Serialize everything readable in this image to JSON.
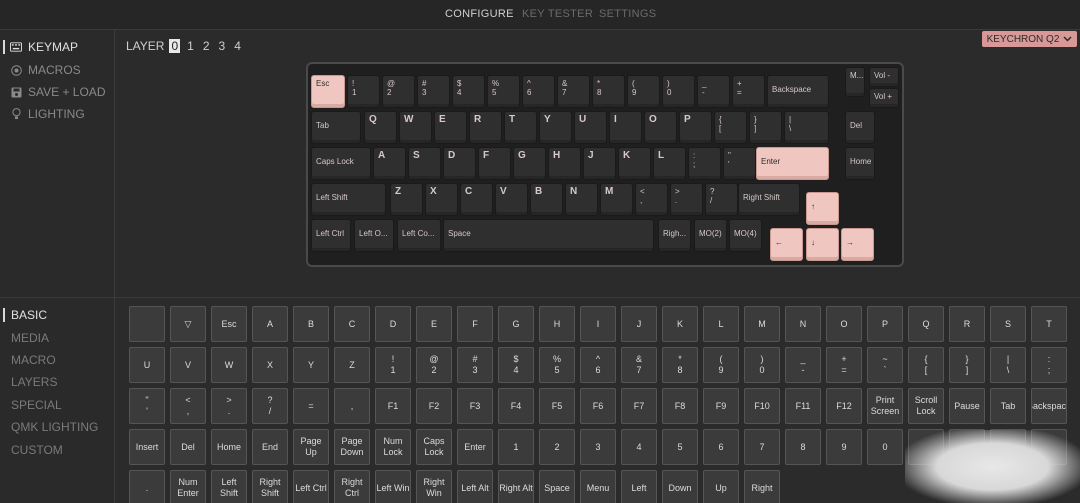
{
  "topbar": {
    "tabs": [
      "CONFIGURE",
      "KEY TESTER",
      "SETTINGS"
    ]
  },
  "sidebar_top": {
    "items": [
      "KEYMAP",
      "MACROS",
      "SAVE + LOAD",
      "LIGHTING"
    ]
  },
  "layer": {
    "label": "LAYER",
    "numbers": [
      "0",
      "1",
      "2",
      "3",
      "4"
    ]
  },
  "keyboard_dropdown": {
    "label": "KEYCHRON Q2"
  },
  "keys": {
    "r1": [
      [
        "Esc",
        ""
      ],
      [
        "!",
        "1"
      ],
      [
        "@",
        "2"
      ],
      [
        "#",
        "3"
      ],
      [
        "$",
        "4"
      ],
      [
        "%",
        "5"
      ],
      [
        "^",
        "6"
      ],
      [
        "&",
        "7"
      ],
      [
        "*",
        "8"
      ],
      [
        "(",
        "9"
      ],
      [
        ")",
        "0"
      ],
      [
        "_",
        "-"
      ],
      [
        "+",
        "="
      ],
      [
        "Backspace",
        ""
      ]
    ],
    "knob": [
      "M...",
      "Vol -",
      "Vol +"
    ],
    "r2": [
      "Tab",
      "Q",
      "W",
      "E",
      "R",
      "T",
      "Y",
      "U",
      "I",
      "O",
      "P"
    ],
    "r2s": [
      [
        "{",
        "["
      ],
      [
        "}",
        "]"
      ],
      [
        "|",
        "\\"
      ]
    ],
    "del": "Del",
    "r3": [
      "Caps Lock",
      "A",
      "S",
      "D",
      "F",
      "G",
      "H",
      "J",
      "K",
      "L"
    ],
    "r3s": [
      [
        ":",
        ";"
      ],
      [
        "\"",
        "'"
      ]
    ],
    "enter": "Enter",
    "home": "Home",
    "r4": [
      "Left Shift",
      "Z",
      "X",
      "C",
      "V",
      "B",
      "N",
      "M"
    ],
    "r4s": [
      [
        "<",
        ","
      ],
      [
        ">",
        "."
      ],
      [
        "?",
        "/"
      ]
    ],
    "rshift": "Right Shift",
    "up": "↑",
    "r5": [
      "Left Ctrl",
      "Left O...",
      "Left Co...",
      "Space",
      "Righ...",
      "MO(2)",
      "MO(4)"
    ],
    "arrows": [
      "←",
      "↓",
      "→"
    ]
  },
  "sidebar_bottom": {
    "items": [
      "BASIC",
      "MEDIA",
      "MACRO",
      "LAYERS",
      "SPECIAL",
      "QMK LIGHTING",
      "CUSTOM"
    ]
  },
  "palette": {
    "row1": [
      "",
      "▽",
      "Esc",
      "A",
      "B",
      "C",
      "D",
      "E",
      "F",
      "G",
      "H",
      "I",
      "J",
      "K",
      "L",
      "M",
      "N",
      "O",
      "P",
      "Q",
      "R",
      "S",
      "T"
    ],
    "row2": [
      "U",
      "V",
      "W",
      "X",
      "Y",
      "Z",
      "!\n1",
      "@\n2",
      "#\n3",
      "$\n4",
      "%\n5",
      "^\n6",
      "&\n7",
      "*\n8",
      "(\n9",
      ")\n0",
      "_\n-",
      "+\n=",
      "~\n`",
      "{\n[",
      "}\n]",
      "|\n\\",
      ":\n;"
    ],
    "row3": [
      "\"\n'",
      "<\n,",
      ">\n.",
      "?\n/",
      "=",
      ",",
      "F1",
      "F2",
      "F3",
      "F4",
      "F5",
      "F6",
      "F7",
      "F8",
      "F9",
      "F10",
      "F11",
      "F12",
      "Print\nScreen",
      "Scroll\nLock",
      "Pause",
      "Tab",
      "Backspace"
    ],
    "row4": [
      "Insert",
      "Del",
      "Home",
      "End",
      "Page Up",
      "Page\nDown",
      "Num\nLock",
      "Caps\nLock",
      "Enter",
      "1",
      "2",
      "3",
      "4",
      "5",
      "6",
      "7",
      "8",
      "9",
      "0",
      "",
      "",
      "",
      ""
    ],
    "row5": [
      ".",
      "Num\nEnter",
      "Left\nShift",
      "Right\nShift",
      "Left Ctrl",
      "Right\nCtrl",
      "Left Win",
      "Right\nWin",
      "Left Alt",
      "Right Alt",
      "Space",
      "Menu",
      "Left",
      "Down",
      "Up",
      "Right"
    ]
  },
  "colors": {
    "accent": "#d99898",
    "key_pink": "#f0c7c0",
    "bg": "#2b2b2b"
  }
}
